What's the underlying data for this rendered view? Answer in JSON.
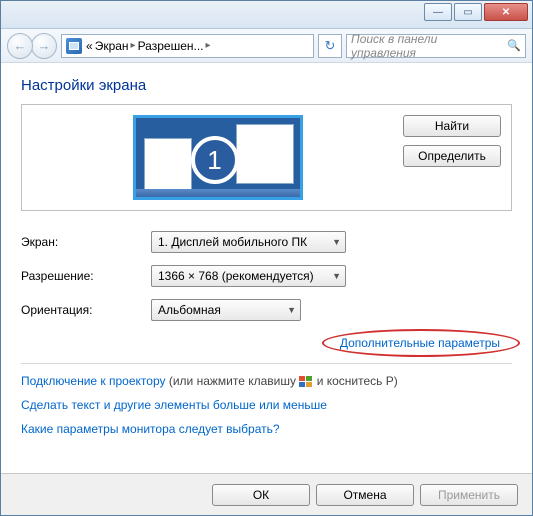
{
  "titlebar": {
    "minimize_glyph": "—",
    "maximize_glyph": "▭",
    "close_glyph": "✕"
  },
  "nav": {
    "back_glyph": "←",
    "forward_glyph": "→",
    "breadcrumb_prefix": "«",
    "breadcrumb_item1": "Экран",
    "breadcrumb_sep": "▸",
    "breadcrumb_item2": "Разрешен...",
    "refresh_glyph": "↻",
    "search_placeholder": "Поиск в панели управления",
    "search_glyph": "🔍"
  },
  "heading": "Настройки экрана",
  "preview": {
    "monitor_number": "1",
    "btn_find": "Найти",
    "btn_identify": "Определить"
  },
  "form": {
    "screen_label": "Экран:",
    "screen_value": "1. Дисплей мобильного ПК",
    "resolution_label": "Разрешение:",
    "resolution_value": "1366 × 768 (рекомендуется)",
    "orientation_label": "Ориентация:",
    "orientation_value": "Альбомная"
  },
  "advanced_link": "Дополнительные параметры",
  "links": {
    "projector": "Подключение к проектору",
    "projector_hint_a": " (или нажмите клавишу ",
    "projector_hint_b": " и коснитесь P)",
    "text_size": "Сделать текст и другие элементы больше или меньше",
    "which_settings": "Какие параметры монитора следует выбрать?"
  },
  "footer": {
    "ok": "ОК",
    "cancel": "Отмена",
    "apply": "Применить"
  }
}
